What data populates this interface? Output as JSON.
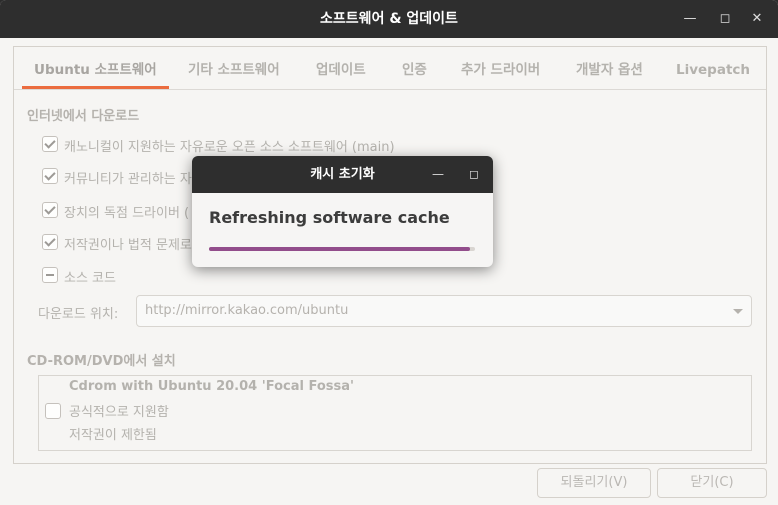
{
  "window": {
    "title": "소프트웨어 & 업데이트"
  },
  "tabs": [
    {
      "label": "Ubuntu 소프트웨어"
    },
    {
      "label": "기타 소프트웨어"
    },
    {
      "label": "업데이트"
    },
    {
      "label": "인증"
    },
    {
      "label": "추가 드라이버"
    },
    {
      "label": "개발자 옵션"
    },
    {
      "label": "Livepatch"
    }
  ],
  "internet": {
    "heading": "인터넷에서 다운로드",
    "items": [
      {
        "label": "캐노니컬이 지원하는 자유로운 오픈 소스 소프트웨어 (main)",
        "state": "checked"
      },
      {
        "label": "커뮤니티가 관리하는 자",
        "state": "checked"
      },
      {
        "label": "장치의 독점 드라이버 (",
        "state": "checked"
      },
      {
        "label": "저작권이나 법적 문제로",
        "state": "checked"
      },
      {
        "label": "소스 코드",
        "state": "mixed"
      }
    ],
    "download_from_label": "다운로드 위치:",
    "download_from_value": "http://mirror.kakao.com/ubuntu"
  },
  "cdrom": {
    "heading": "CD-ROM/DVD에서 설치",
    "title": "Cdrom with Ubuntu 20.04 'Focal Fossa'",
    "line1": "공식적으로 지원함",
    "line2": "저작권이 제한됨"
  },
  "buttons": {
    "revert": "되돌리기(V)",
    "close": "닫기(C)"
  },
  "dialog": {
    "title": "캐시 초기화",
    "message": "Refreshing software cache",
    "progress": 0.98,
    "progress_color": "#924d8b"
  },
  "colors": {
    "accent": "#e95420",
    "titlebar": "#2e2e2e"
  }
}
